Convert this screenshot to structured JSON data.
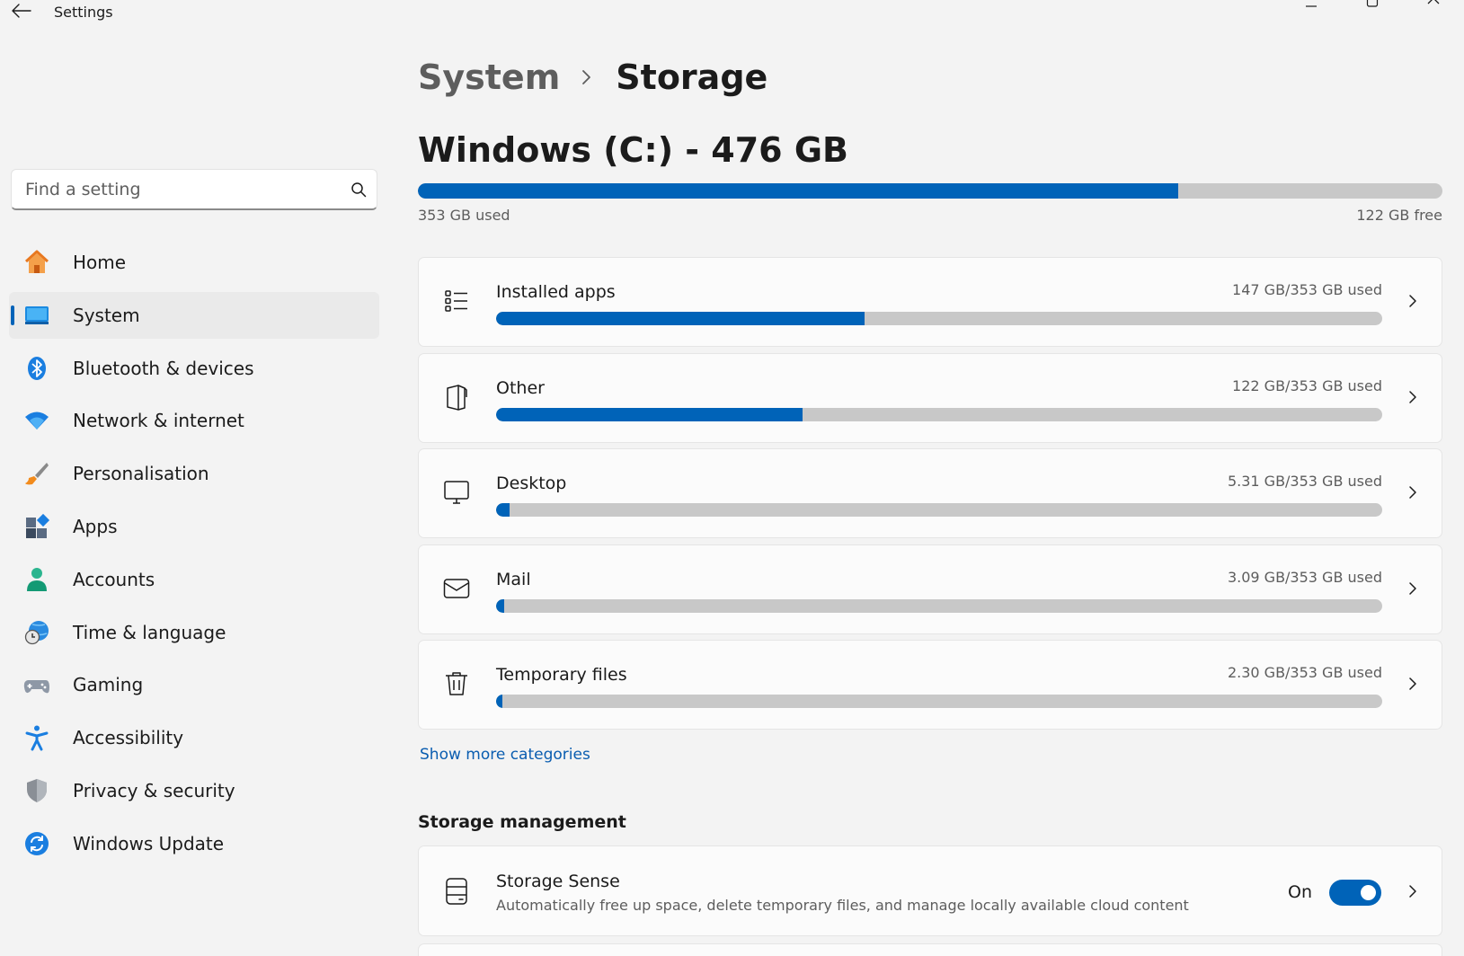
{
  "window": {
    "title": "Settings",
    "back_icon": "arrow-left-icon",
    "controls": [
      "minimize-icon",
      "maximize-icon",
      "close-icon"
    ]
  },
  "search": {
    "placeholder": "Find a setting",
    "value": "",
    "icon": "search-icon"
  },
  "sidebar": {
    "items": [
      {
        "label": "Home",
        "icon": "home-icon",
        "selected": false
      },
      {
        "label": "System",
        "icon": "system-monitor-icon",
        "selected": true
      },
      {
        "label": "Bluetooth & devices",
        "icon": "bluetooth-icon",
        "selected": false
      },
      {
        "label": "Network & internet",
        "icon": "wifi-icon",
        "selected": false
      },
      {
        "label": "Personalisation",
        "icon": "paintbrush-icon",
        "selected": false
      },
      {
        "label": "Apps",
        "icon": "apps-icon",
        "selected": false
      },
      {
        "label": "Accounts",
        "icon": "person-icon",
        "selected": false
      },
      {
        "label": "Time & language",
        "icon": "globe-clock-icon",
        "selected": false
      },
      {
        "label": "Gaming",
        "icon": "gamepad-icon",
        "selected": false
      },
      {
        "label": "Accessibility",
        "icon": "accessibility-icon",
        "selected": false
      },
      {
        "label": "Privacy & security",
        "icon": "shield-icon",
        "selected": false
      },
      {
        "label": "Windows Update",
        "icon": "update-icon",
        "selected": false
      }
    ]
  },
  "breadcrumb": {
    "parent": "System",
    "current": "Storage"
  },
  "drive": {
    "title": "Windows (C:) - 476 GB",
    "used_label": "353 GB used",
    "free_label": "122 GB free",
    "used_fraction": 0.742
  },
  "categories": [
    {
      "name": "Installed apps",
      "usage": "147 GB/353 GB used",
      "fraction": 0.416,
      "icon": "list-icon"
    },
    {
      "name": "Other",
      "usage": "122 GB/353 GB used",
      "fraction": 0.346,
      "icon": "document-icon"
    },
    {
      "name": "Desktop",
      "usage": "5.31 GB/353 GB used",
      "fraction": 0.015,
      "icon": "desktop-icon"
    },
    {
      "name": "Mail",
      "usage": "3.09 GB/353 GB used",
      "fraction": 0.009,
      "icon": "mail-icon"
    },
    {
      "name": "Temporary files",
      "usage": "2.30 GB/353 GB used",
      "fraction": 0.007,
      "icon": "trash-icon"
    }
  ],
  "show_more": "Show more categories",
  "management": {
    "title": "Storage management",
    "storage_sense": {
      "name": "Storage Sense",
      "description": "Automatically free up space, delete temporary files, and manage locally available cloud content",
      "toggle_label": "On",
      "enabled": true,
      "icon": "storage-drive-icon"
    }
  },
  "colors": {
    "accent": "#0063b8",
    "bar_track": "#c8c8c8",
    "link": "#0a5db0"
  }
}
